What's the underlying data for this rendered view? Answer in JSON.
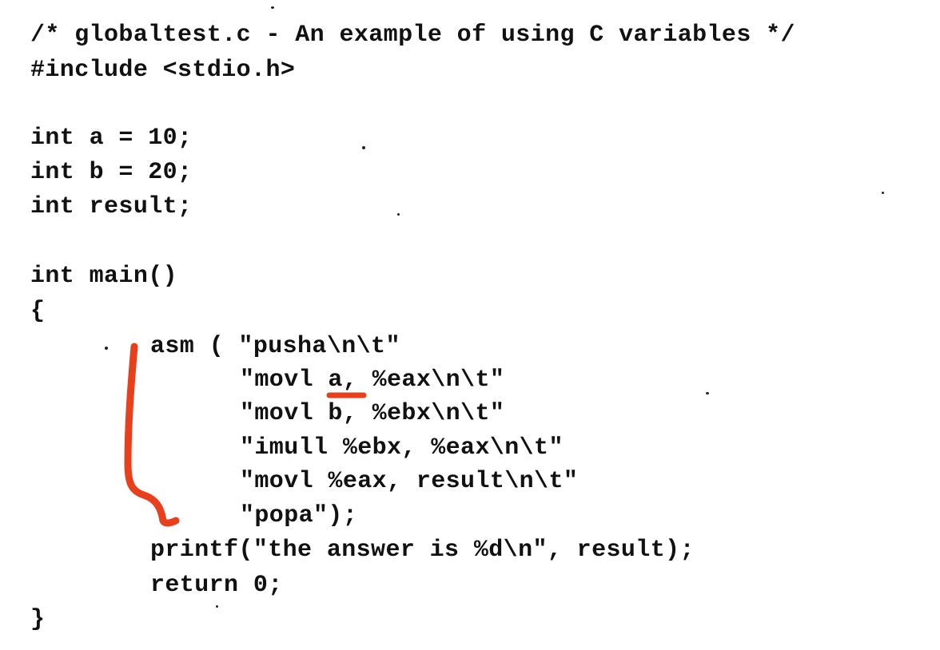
{
  "code": {
    "lines": [
      "/* globaltest.c - An example of using C variables */",
      "#include <stdio.h>",
      "int a = 10;",
      "int b = 20;",
      "int result;",
      "int main()",
      "{",
      "asm ( \"pusha\\n\\t\"",
      "\"movl a, %eax\\n\\t\"",
      "\"movl b, %ebx\\n\\t\"",
      "\"imull %ebx, %eax\\n\\t\"",
      "\"movl %eax, result\\n\\t\"",
      "\"popa\");",
      "printf(\"the answer is %d\\n\", result);",
      "return 0;",
      "}"
    ]
  },
  "annotation_color": "#e8401c"
}
